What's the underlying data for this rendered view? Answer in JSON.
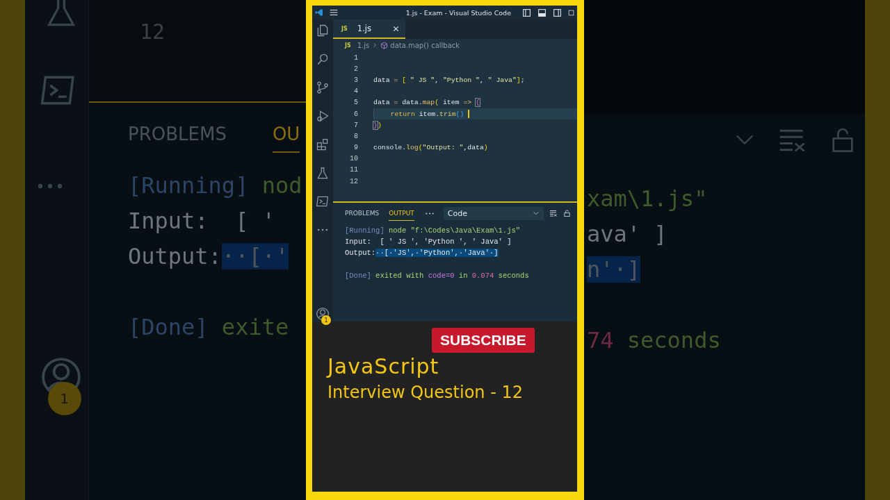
{
  "backdrop": {
    "left": {
      "line_number": "12",
      "tabs": [
        {
          "label": "PROBLEMS",
          "selected": false
        },
        {
          "label": "OU",
          "selected": true
        }
      ],
      "account_badge": "1",
      "lines": [
        {
          "spaced": false,
          "tokens": [
            {
              "t": "[Running]",
              "kind": "tag"
            },
            {
              "t": " nod",
              "kind": "cmd"
            }
          ]
        },
        {
          "spaced": false,
          "tokens": [
            {
              "t": "Input:  [ '",
              "kind": "plain"
            }
          ]
        },
        {
          "spaced": false,
          "tokens": [
            {
              "t": "Output:",
              "kind": "plain"
            },
            {
              "t": "··[·'",
              "kind": "sel"
            }
          ]
        },
        {
          "spaced": true,
          "tokens": [
            {
              "t": "[Done]",
              "kind": "tag"
            },
            {
              "t": " exite",
              "kind": "cmd"
            }
          ]
        }
      ]
    },
    "right": {
      "lines": [
        {
          "spaced": false,
          "tokens": [
            {
              "t": "xam\\1.js\"",
              "kind": "cmd"
            }
          ]
        },
        {
          "spaced": false,
          "tokens": [
            {
              "t": "ava' ]",
              "kind": "plain"
            }
          ]
        },
        {
          "spaced": false,
          "tokens": [
            {
              "t": "n'·]",
              "kind": "sel"
            }
          ]
        },
        {
          "spaced": true,
          "tokens": [
            {
              "t": "74",
              "kind": "num"
            },
            {
              "t": " seconds",
              "kind": "cmd"
            }
          ]
        }
      ]
    }
  },
  "window": {
    "title": "1.js - Exam - Visual Studio Code"
  },
  "activity_bar": {
    "account_badge": "1"
  },
  "tabs": [
    {
      "file_type": "JS",
      "label": "1.js",
      "selected": true
    }
  ],
  "breadcrumb": {
    "file_type": "JS",
    "file": "1.js",
    "symbol": "data.map() callback"
  },
  "editor": {
    "lines": [
      {
        "number": "1",
        "current": false,
        "cursor": false
      },
      {
        "number": "2",
        "current": false,
        "cursor": false
      },
      {
        "number": "3",
        "current": false,
        "cursor": false,
        "tokens": [
          {
            "t": "data ",
            "kind": "plain"
          },
          {
            "t": "=",
            "kind": "op"
          },
          {
            "t": " [",
            "kind": "br1"
          },
          {
            "t": " \" JS \"",
            "kind": "str"
          },
          {
            "t": ", ",
            "kind": "plain"
          },
          {
            "t": "\"Python \"",
            "kind": "str"
          },
          {
            "t": ", ",
            "kind": "plain"
          },
          {
            "t": "\" Java\"",
            "kind": "str"
          },
          {
            "t": "]",
            "kind": "br1"
          },
          {
            "t": ";",
            "kind": "plain"
          }
        ]
      },
      {
        "number": "4",
        "current": false,
        "cursor": false
      },
      {
        "number": "5",
        "current": false,
        "cursor": false,
        "tokens": [
          {
            "t": "data ",
            "kind": "plain"
          },
          {
            "t": "=",
            "kind": "op"
          },
          {
            "t": " data.",
            "kind": "plain"
          },
          {
            "t": "map",
            "kind": "fn"
          },
          {
            "t": "(",
            "kind": "br1"
          },
          {
            "t": " item ",
            "kind": "plain"
          },
          {
            "t": "=> ",
            "kind": "op"
          },
          {
            "t": "{",
            "kind": "br2",
            "matched": true
          }
        ]
      },
      {
        "number": "6",
        "current": true,
        "cursor": true,
        "tokens": [
          {
            "t": "    return",
            "kind": "kw"
          },
          {
            "t": " item.",
            "kind": "plain"
          },
          {
            "t": "trim",
            "kind": "fn"
          },
          {
            "t": "()",
            "kind": "br3"
          }
        ]
      },
      {
        "number": "7",
        "current": false,
        "cursor": false,
        "tokens": [
          {
            "t": "}",
            "kind": "br2",
            "matched": true
          },
          {
            "t": ")",
            "kind": "br1"
          }
        ]
      },
      {
        "number": "8",
        "current": false,
        "cursor": false
      },
      {
        "number": "9",
        "current": false,
        "cursor": false,
        "tokens": [
          {
            "t": "console.",
            "kind": "plain"
          },
          {
            "t": "log",
            "kind": "fn"
          },
          {
            "t": "(",
            "kind": "br1"
          },
          {
            "t": "\"Output: \"",
            "kind": "str"
          },
          {
            "t": ",data",
            "kind": "plain"
          },
          {
            "t": ")",
            "kind": "br1"
          }
        ]
      },
      {
        "number": "10",
        "current": false,
        "cursor": false
      },
      {
        "number": "11",
        "current": false,
        "cursor": false
      },
      {
        "number": "12",
        "current": false,
        "cursor": false
      }
    ]
  },
  "panel": {
    "tabs": [
      {
        "label": "PROBLEMS",
        "selected": false
      },
      {
        "label": "OUTPUT",
        "selected": true
      }
    ],
    "channel": "Code",
    "output": [
      {
        "spaced": false,
        "tokens": [
          {
            "t": "[Running]",
            "kind": "tag"
          },
          {
            "t": " node \"f:\\Codes\\Java\\Exam\\1.js\"",
            "kind": "cmd"
          }
        ]
      },
      {
        "spaced": false,
        "tokens": [
          {
            "t": "Input:  [ ' JS ', 'Python ', ' Java' ]",
            "kind": "plain"
          }
        ]
      },
      {
        "spaced": false,
        "tokens": [
          {
            "t": "Output:",
            "kind": "plain"
          },
          {
            "t": "··[·'JS',·'Python',·'Java'·]",
            "kind": "sel"
          }
        ]
      },
      {
        "spaced": true,
        "tokens": [
          {
            "t": "[Done]",
            "kind": "tag"
          },
          {
            "t": " exited with ",
            "kind": "cmd"
          },
          {
            "t": "code=0",
            "kind": "code"
          },
          {
            "t": " in ",
            "kind": "cmd"
          },
          {
            "t": "0.074",
            "kind": "num"
          },
          {
            "t": " seconds",
            "kind": "cmd"
          }
        ]
      }
    ]
  },
  "promo": {
    "button": "SUBSCRIBE",
    "title": "JavaScript",
    "subtitle": "Interview Question - 12"
  }
}
